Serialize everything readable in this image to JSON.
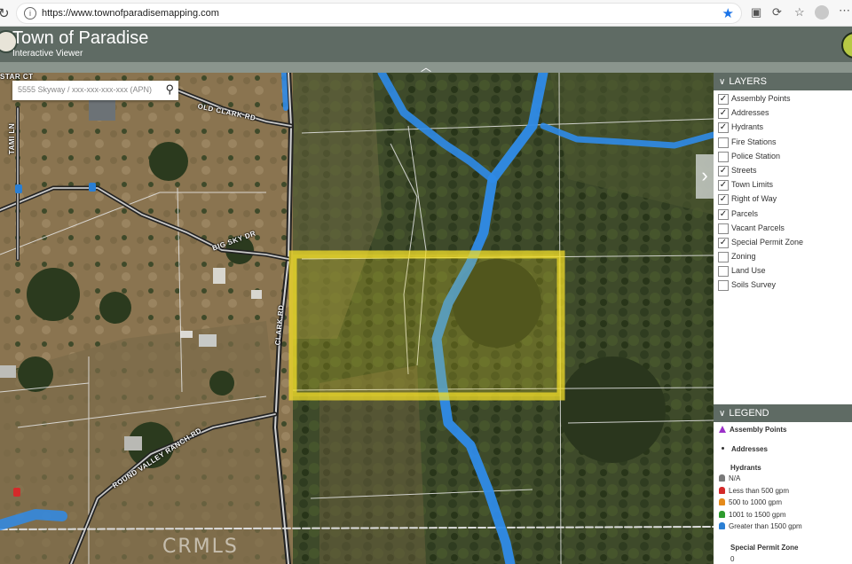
{
  "browser": {
    "url": "https://www.townofparadisemapping.com"
  },
  "app": {
    "title": "Town of Paradise",
    "subtitle": "Interactive Viewer"
  },
  "search": {
    "placeholder": "5555 Skyway / xxx-xxx-xxx-xxx (APN)"
  },
  "map": {
    "road_labels": {
      "old_clark": "OLD CLARK RD",
      "big_sky": "BIG SKY DR",
      "clark": "CLARK RD",
      "round_valley": "ROUND VALLEY RANCH RD",
      "tami": "TAMI LN",
      "star_ct": "STAR CT"
    },
    "watermark": "CRMLS"
  },
  "layers": {
    "title": "LAYERS",
    "items": [
      {
        "label": "Assembly Points",
        "checked": true
      },
      {
        "label": "Addresses",
        "checked": true
      },
      {
        "label": "Hydrants",
        "checked": true
      },
      {
        "label": "Fire Stations",
        "checked": false
      },
      {
        "label": "Police Station",
        "checked": false
      },
      {
        "label": "Streets",
        "checked": true
      },
      {
        "label": "Town Limits",
        "checked": true
      },
      {
        "label": "Right of Way",
        "checked": true
      },
      {
        "label": "Parcels",
        "checked": true
      },
      {
        "label": "Vacant Parcels",
        "checked": false
      },
      {
        "label": "Special Permit Zone",
        "checked": true
      },
      {
        "label": "Zoning",
        "checked": false
      },
      {
        "label": "Land Use",
        "checked": false
      },
      {
        "label": "Soils Survey",
        "checked": false
      }
    ]
  },
  "legend": {
    "title": "LEGEND",
    "assembly_points": "Assembly Points",
    "addresses": "Addresses",
    "hydrants_title": "Hydrants",
    "hydrants": [
      {
        "label": "N/A",
        "color": "#7a7a7a"
      },
      {
        "label": "Less than 500 gpm",
        "color": "#d42a2a"
      },
      {
        "label": "500 to 1000 gpm",
        "color": "#e58a1a"
      },
      {
        "label": "1001 to 1500 gpm",
        "color": "#2e9b2e"
      },
      {
        "label": "Greater than 1500 gpm",
        "color": "#2a7fd4"
      }
    ],
    "special_permit_title": "Special Permit Zone",
    "special_permit_value": "0"
  },
  "colors": {
    "header": "#5f6b64",
    "parcel_highlight": "#f2dd2a",
    "stream": "#2f8be8"
  }
}
